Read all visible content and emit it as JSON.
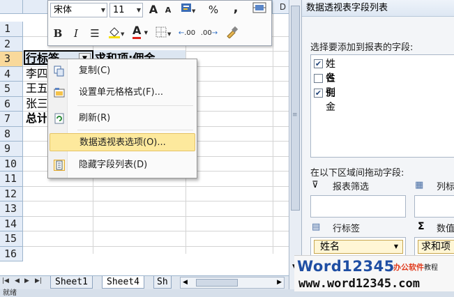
{
  "grid": {
    "column_headers": [
      "D"
    ],
    "row_numbers": [
      "1",
      "2",
      "3",
      "4",
      "5",
      "6",
      "7",
      "8",
      "9",
      "10",
      "11",
      "12",
      "13",
      "14",
      "15",
      "16"
    ],
    "cells": {
      "a3": "行标签",
      "b3": "求和项:佣金",
      "a4": "李四",
      "a5": "王五",
      "a6": "张三",
      "a7": "总计"
    }
  },
  "mini_toolbar": {
    "font_name": "宋体",
    "font_size": "11",
    "grow_font": "A",
    "shrink_font": "A",
    "percent": "%",
    "comma": ",",
    "bold": "B",
    "italic": "I",
    "font_color_letter": "A",
    "increase_decimal": ".00",
    "decrease_decimal": ".00"
  },
  "context_menu": {
    "items": [
      {
        "label": "复制(C)"
      },
      {
        "label": "设置单元格格式(F)..."
      },
      {
        "label": "刷新(R)"
      },
      {
        "label": "数据透视表选项(O)..."
      },
      {
        "label": "隐藏字段列表(D)"
      }
    ]
  },
  "sheet_tabs": {
    "tabs": [
      "Sheet1",
      "Sheet4",
      "Sh"
    ]
  },
  "status": {
    "text": "就绪"
  },
  "field_list": {
    "title": "数据透视表字段列表",
    "prompt": "选择要添加到报表的字段:",
    "fields": [
      {
        "label": "姓名",
        "checked": true
      },
      {
        "label": "性别",
        "checked": false
      },
      {
        "label": "佣金",
        "checked": true
      }
    ],
    "drag_prompt": "在以下区域间拖动字段:",
    "areas": {
      "report_filter": "报表筛选",
      "columns": "列标",
      "row_labels": "行标签",
      "values": "数值"
    },
    "row_chip": "姓名",
    "value_chip": "求和项"
  },
  "watermark": {
    "brand": "Word12345",
    "tagline": "办公软件",
    "tagline2": "教程",
    "url": "www.word12345.com"
  },
  "colors": {
    "menu_highlight": "#fde99d",
    "header_bg": "#e4ecf7",
    "selected_row_header": "#f9d99b",
    "watermark_blue": "#1f4ea3",
    "watermark_red": "#e03a1c"
  }
}
